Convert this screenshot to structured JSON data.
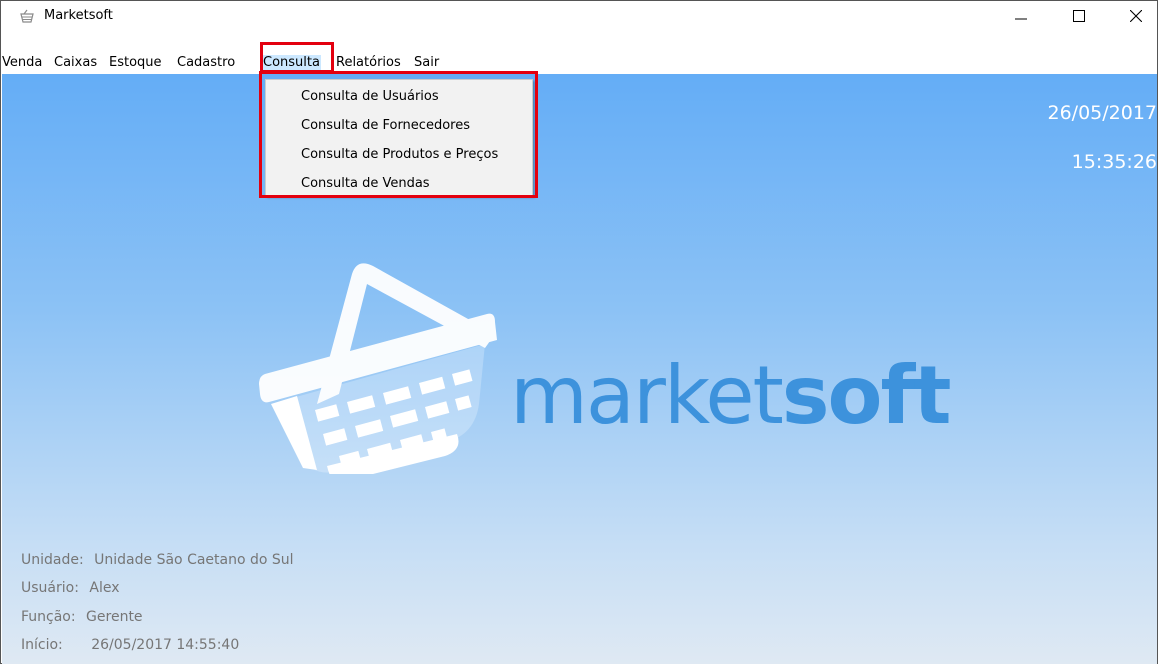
{
  "window": {
    "title": "Marketsoft",
    "controls": [
      "minimize",
      "maximize",
      "close"
    ]
  },
  "menubar": {
    "items": [
      {
        "label": "Venda"
      },
      {
        "label": "Caixas"
      },
      {
        "label": "Estoque"
      },
      {
        "label": "Cadastro"
      },
      {
        "label": "Consulta",
        "active": true
      },
      {
        "label": "Relatórios"
      },
      {
        "label": "Sair"
      }
    ]
  },
  "consulta_menu": {
    "items": [
      {
        "label": "Consulta de Usuários"
      },
      {
        "label": "Consulta de Fornecedores"
      },
      {
        "label": "Consulta de Produtos e Preços"
      },
      {
        "label": "Consulta de Vendas"
      }
    ]
  },
  "clock": {
    "date": "26/05/2017",
    "time": "15:35:26"
  },
  "logo": {
    "word_light": "market",
    "word_bold": "soft",
    "icon": "shopping-basket-icon"
  },
  "session_info": {
    "unidade_label": "Unidade:",
    "unidade_value": "Unidade São Caetano do Sul",
    "usuario_label": "Usuário:",
    "usuario_value": "Alex",
    "funcao_label": "Função:",
    "funcao_value": "Gerente",
    "inicio_label": "Início:",
    "inicio_value": "26/05/2017 14:55:40"
  },
  "colors": {
    "highlight": "#e3000f",
    "menu_active": "#cce8ff",
    "background_top": "#64adf6",
    "background_bottom": "#dfe9f3",
    "logo_text": "#3d92dc"
  }
}
